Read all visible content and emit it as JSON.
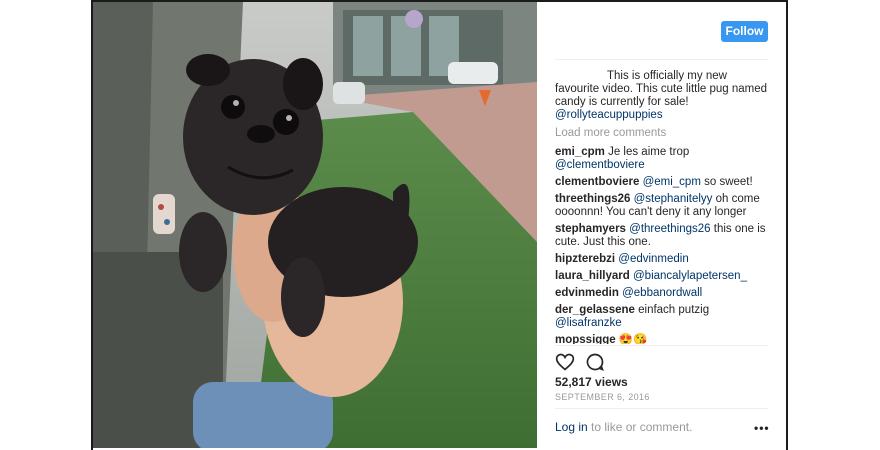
{
  "post": {
    "follow_label": "Follow",
    "caption_text": "This is officially my new favourite video. This cute little pug named candy is currently for sale!",
    "caption_mention": "@rollyteacuppuppies",
    "load_more": "Load more comments",
    "comments": [
      {
        "user": "emi_cpm",
        "text": "Je les aime trop",
        "mention": "@clementboviere"
      },
      {
        "user": "clementboviere",
        "mention": "@emi_cpm",
        "text": "so sweet!"
      },
      {
        "user": "threethings26",
        "mention": "@stephanitelyy",
        "text": "oh come oooonnn! You can't deny it any longer"
      },
      {
        "user": "stephamyers",
        "mention": "@threethings26",
        "text": "this one is cute. Just this one."
      },
      {
        "user": "hipzterebzi",
        "mention": "@edvinmedin",
        "text": ""
      },
      {
        "user": "laura_hillyard",
        "mention": "@biancalylapetersen_",
        "text": ""
      },
      {
        "user": "edvinmedin",
        "mention": "@ebbanordwall",
        "text": ""
      },
      {
        "user": "der_gelassene",
        "text": "einfach putzig",
        "mention": "@lisafranzke"
      },
      {
        "user": "mopssigge",
        "text": "😍😘",
        "mention": ""
      }
    ],
    "views": "52,817 views",
    "date": "SEPTEMBER 6, 2016",
    "login_link": "Log in",
    "login_suffix": "to like or comment.",
    "more_label": "•••",
    "icons": {
      "like": "heart-icon",
      "comment": "comment-bubble-icon",
      "more": "more-options-icon"
    },
    "colors": {
      "accent": "#3897f0",
      "link": "#003569",
      "muted": "#999999"
    }
  }
}
